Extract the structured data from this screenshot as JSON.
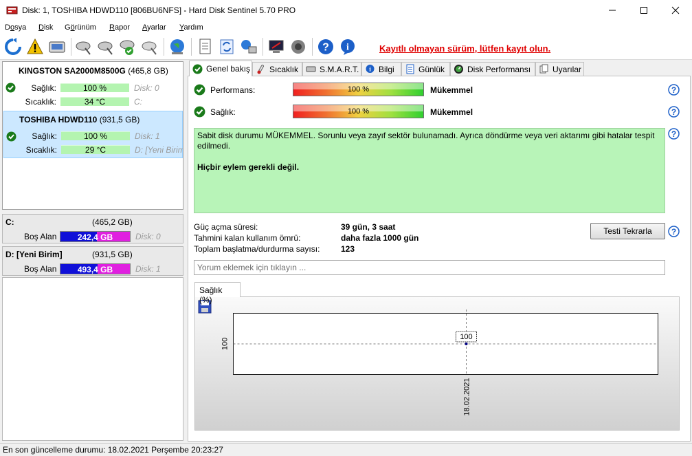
{
  "window": {
    "title": "Disk: 1, TOSHIBA HDWD110 [806BU6NFS]  -  Hard Disk Sentinel 5.70 PRO"
  },
  "menu": [
    {
      "pre": "D",
      "ul": "o",
      "post": "sya"
    },
    {
      "pre": "",
      "ul": "D",
      "post": "isk"
    },
    {
      "pre": "G",
      "ul": "ö",
      "post": "rünüm"
    },
    {
      "pre": "",
      "ul": "R",
      "post": "apor"
    },
    {
      "pre": "",
      "ul": "A",
      "post": "yarlar"
    },
    {
      "pre": "",
      "ul": "Y",
      "post": "ardım"
    }
  ],
  "toolbar": {
    "register_link": "Kayıtlı olmayan sürüm, lütfen kayıt olun."
  },
  "disks": [
    {
      "name": "KINGSTON SA2000M8500G",
      "size": "(465,8 GB)",
      "health_label": "Sağlık:",
      "health": "100 %",
      "health_pct": 100,
      "health_disk": "Disk: 0",
      "temp_label": "Sıcaklık:",
      "temp": "34 °C",
      "temp_pct": 100,
      "drive": "C:"
    },
    {
      "name": "TOSHIBA HDWD110",
      "size": "(931,5 GB)",
      "health_label": "Sağlık:",
      "health": "100 %",
      "health_pct": 100,
      "health_disk": "Disk: 1",
      "temp_label": "Sıcaklık:",
      "temp": "29 °C",
      "temp_pct": 100,
      "drive": "D: [Yeni Birim"
    }
  ],
  "partitions": [
    {
      "name": "C:",
      "size": "(465,2 GB)",
      "free_label": "Boş Alan",
      "free": "242,4 GB",
      "used_fraction": 0.52,
      "disk": "Disk: 0"
    },
    {
      "name": "D: [Yeni Birim]",
      "size": "(931,5 GB)",
      "free_label": "Boş Alan",
      "free": "493,4 GB",
      "used_fraction": 0.53,
      "disk": "Disk: 1"
    }
  ],
  "tabs": [
    "Genel bakış",
    "Sıcaklık",
    "S.M.A.R.T.",
    "Bilgi",
    "Günlük",
    "Disk Performansı",
    "Uyarılar"
  ],
  "overview": {
    "performance_label": "Performans:",
    "performance_value": "100 %",
    "performance_pct": 100,
    "performance_rating": "Mükemmel",
    "health_label": "Sağlık:",
    "health_value": "100 %",
    "health_pct": 100,
    "health_rating": "Mükemmel",
    "status_text": "Sabit disk durumu MÜKEMMEL. Sorunlu veya zayıf sektör bulunamadı. Ayrıca döndürme veya veri aktarımı gibi hatalar tespit edilmedi.",
    "status_action": "Hiçbir eylem gerekli değil.",
    "power_on_label": "Güç açma süresi:",
    "power_on_value": "39 gün, 3 saat",
    "lifetime_label": "Tahmini kalan kullanım ömrü:",
    "lifetime_value": "daha fazla 1000 gün",
    "startstop_label": "Toplam başlatma/durdurma sayısı:",
    "startstop_value": "123",
    "retest_button": "Testi Tekrarla",
    "comment_placeholder": "Yorum eklemek için tıklayın ..."
  },
  "chart_data": {
    "type": "line",
    "tab": "Sağlık (%)",
    "x": [
      "18.02.2021"
    ],
    "series": [
      {
        "values": [
          100
        ]
      }
    ],
    "y_tick_labels": [
      "100"
    ],
    "point_labels": [
      "100"
    ]
  },
  "statusbar": {
    "text": "En son güncelleme durumu: 18.02.2021 Perşembe 20:23:27"
  }
}
